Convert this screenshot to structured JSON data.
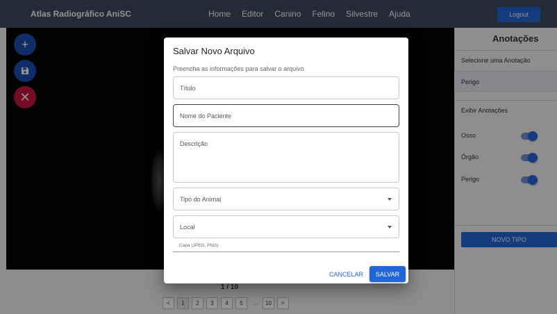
{
  "app": {
    "brand": "Atlas Radiográfico AniSC",
    "nav": [
      "Home",
      "Editor",
      "Canino",
      "Felino",
      "Silvestre",
      "Ajuda"
    ],
    "logout_label": "Logout"
  },
  "viewer": {
    "page_indicator": "1 / 10",
    "pagination": {
      "prev": "<",
      "pages": [
        "1",
        "2",
        "3",
        "4",
        "5"
      ],
      "ellipsis": "...",
      "last": "10",
      "next": ">"
    }
  },
  "panel": {
    "title": "Anotações",
    "select_label": "Selecione uma Anotação",
    "selected": "Perigo",
    "display_label": "Exibir Anotações",
    "toggles": [
      {
        "label": "Osso",
        "on": true
      },
      {
        "label": "Órgão",
        "on": true
      },
      {
        "label": "Perigo",
        "on": true
      }
    ],
    "new_type_button": "NOVO TIPO"
  },
  "dialog": {
    "title": "Salvar Novo Arquivo",
    "subtitle": "Preencha as informações para salvar o arquivo",
    "fields": {
      "title": "Título",
      "patient": "Nome do Paciente",
      "description": "Descrição",
      "animal_type": "Tipo do Animal",
      "location": "Local"
    },
    "file_label": "Capa (JPEG, PNG)",
    "cancel": "CANCELAR",
    "save": "SALVAR"
  },
  "colors": {
    "navbar": "#3b4a5e",
    "primary": "#2166d8",
    "danger": "#c8153f"
  }
}
